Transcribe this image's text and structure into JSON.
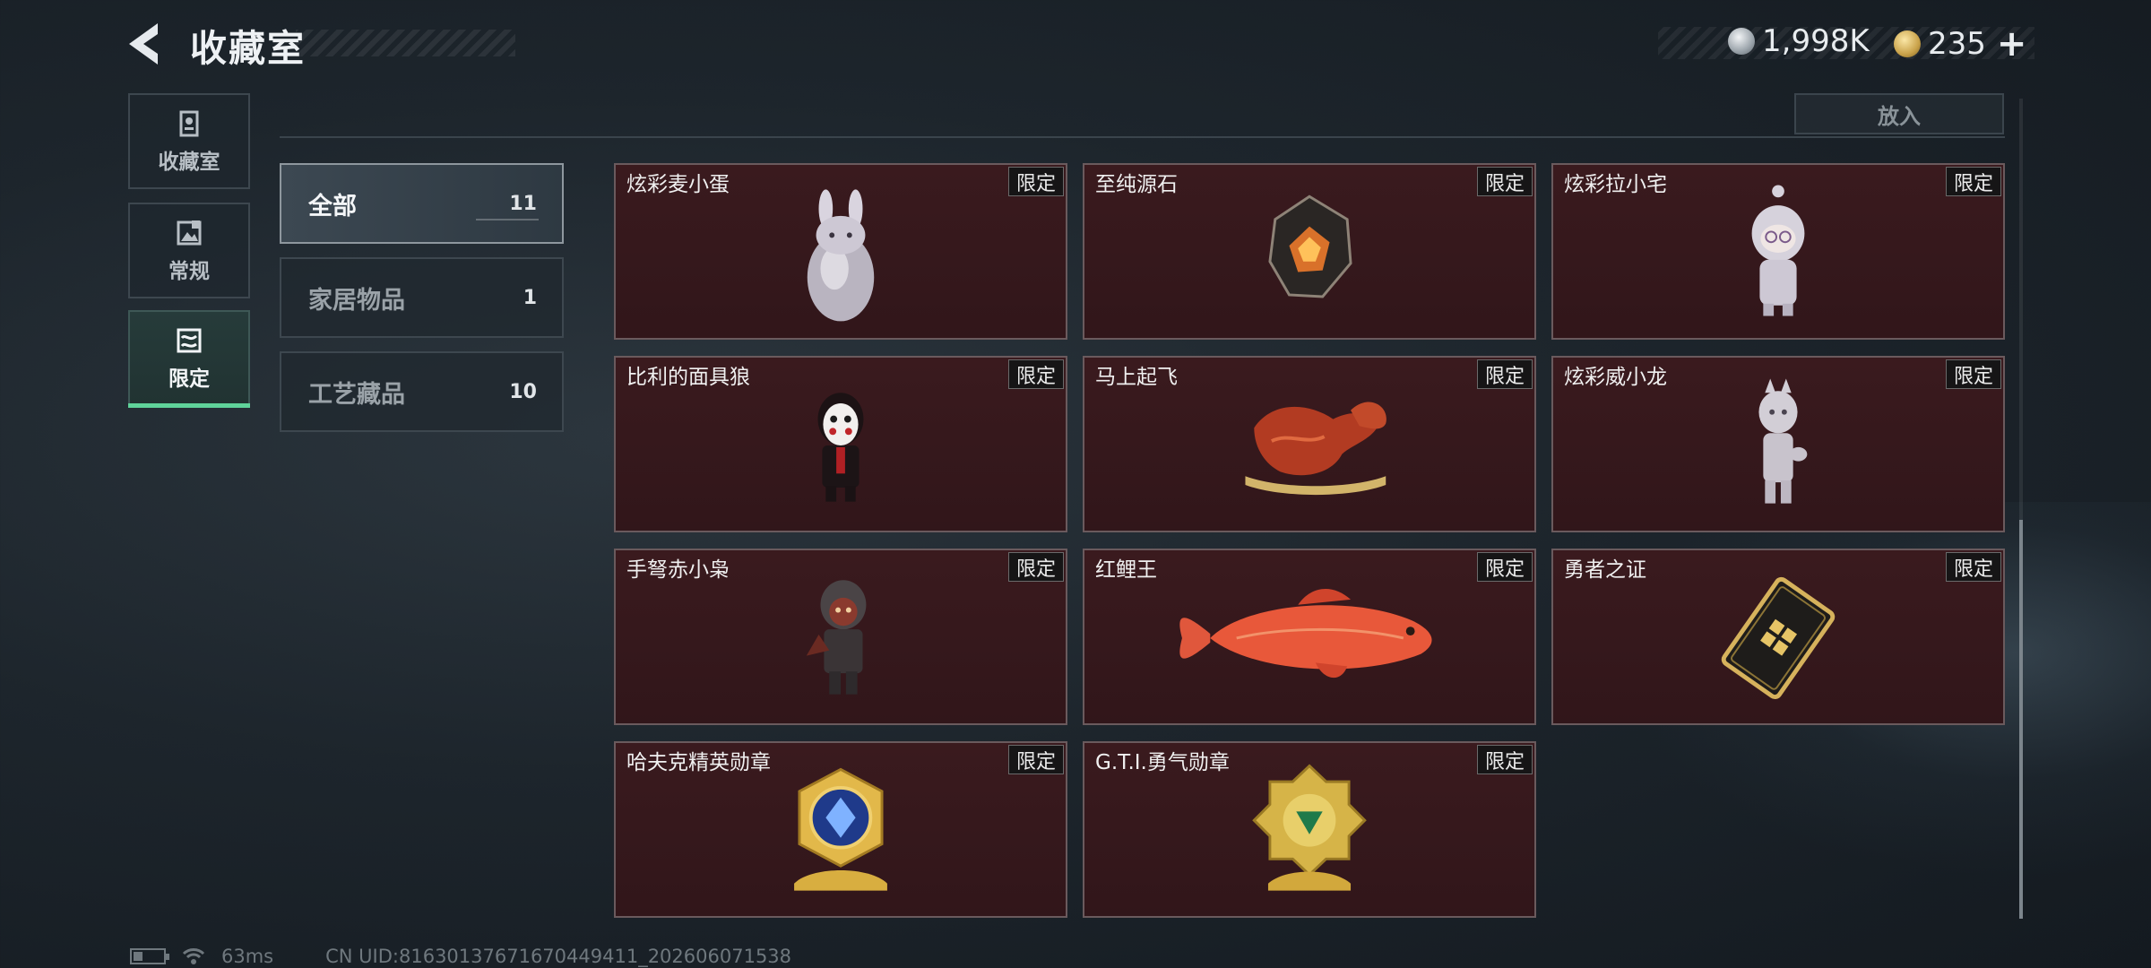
{
  "header": {
    "title": "收藏室",
    "currency_silver": "1,998K",
    "currency_gold": "235",
    "plus_label": "+"
  },
  "nav": {
    "items": [
      {
        "label": "收藏室",
        "icon": "collection-icon",
        "active": false
      },
      {
        "label": "常规",
        "icon": "regular-icon",
        "active": false
      },
      {
        "label": "限定",
        "icon": "limited-icon",
        "active": true
      }
    ]
  },
  "top_row": {
    "put_button": "放入"
  },
  "categories": [
    {
      "label": "全部",
      "count": "11",
      "active": true
    },
    {
      "label": "家居物品",
      "count": "1",
      "active": false
    },
    {
      "label": "工艺藏品",
      "count": "10",
      "active": false
    }
  ],
  "items": [
    {
      "name": "炫彩麦小蛋",
      "tag": "限定",
      "icon": "bunny-egg-icon"
    },
    {
      "name": "至纯源石",
      "tag": "限定",
      "icon": "gem-stone-icon"
    },
    {
      "name": "炫彩拉小宅",
      "tag": "限定",
      "icon": "hooded-figure-icon"
    },
    {
      "name": "比利的面具狼",
      "tag": "限定",
      "icon": "masked-puppet-icon"
    },
    {
      "name": "马上起飞",
      "tag": "限定",
      "icon": "horse-sculpture-icon"
    },
    {
      "name": "炫彩威小龙",
      "tag": "限定",
      "icon": "dragon-figure-icon"
    },
    {
      "name": "手弩赤小枭",
      "tag": "限定",
      "icon": "hooded-archer-icon"
    },
    {
      "name": "红鲤王",
      "tag": "限定",
      "icon": "carp-fish-icon"
    },
    {
      "name": "勇者之证",
      "tag": "限定",
      "icon": "card-plaque-icon"
    },
    {
      "name": "哈夫克精英勋章",
      "tag": "限定",
      "icon": "medal-blue-icon"
    },
    {
      "name": "G.T.I.勇气勋章",
      "tag": "限定",
      "icon": "medal-green-icon"
    }
  ],
  "footer": {
    "ping": "63ms",
    "uid": "CN UID:816301376716704494​11_202606071538"
  },
  "colors": {
    "accent_green": "#5fd39a",
    "card_bg": "#3a1a1e"
  }
}
